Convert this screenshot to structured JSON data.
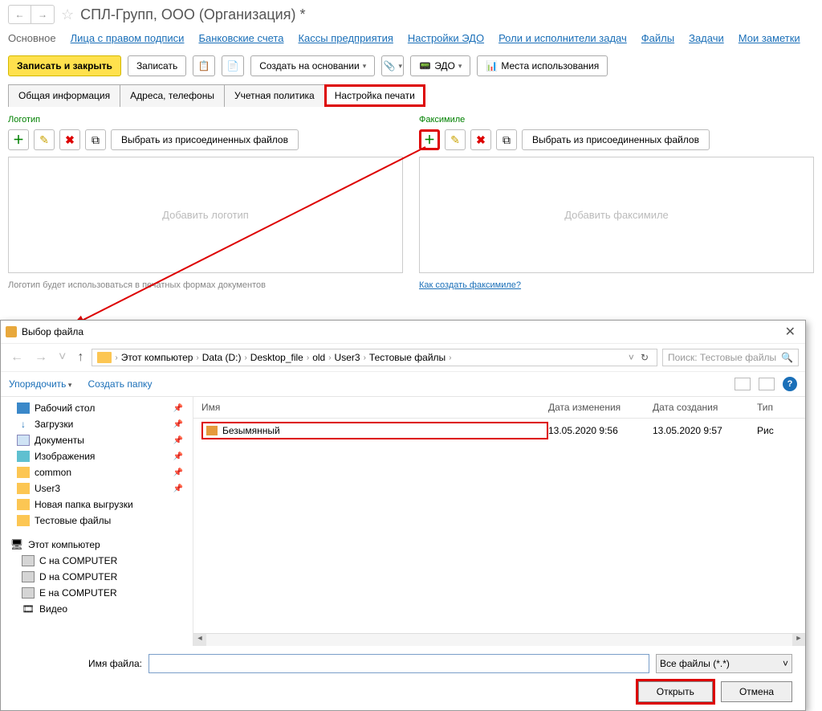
{
  "header": {
    "title": "СПЛ-Групп, ООО (Организация) *"
  },
  "nav": {
    "main": "Основное",
    "links": [
      "Лица с правом подписи",
      "Банковские счета",
      "Кассы предприятия",
      "Настройки ЭДО",
      "Роли и исполнители задач",
      "Файлы",
      "Задачи",
      "Мои заметки"
    ]
  },
  "toolbar": {
    "save_close": "Записать и закрыть",
    "save": "Записать",
    "create_based": "Создать на основании",
    "edo": "ЭДО",
    "usage": "Места использования"
  },
  "tabs": [
    "Общая информация",
    "Адреса, телефоны",
    "Учетная политика",
    "Настройка печати"
  ],
  "logo_panel": {
    "title": "Логотип",
    "select_btn": "Выбрать из присоединенных файлов",
    "placeholder": "Добавить логотип",
    "hint": "Логотип будет использоваться в печатных формах документов"
  },
  "fax_panel": {
    "title": "Факсимиле",
    "select_btn": "Выбрать  из присоединенных файлов",
    "placeholder": "Добавить факсимиле",
    "hint": "Как создать факсимиле?"
  },
  "file_dialog": {
    "title": "Выбор файла",
    "breadcrumbs": [
      "Этот компьютер",
      "Data (D:)",
      "Desktop_file",
      "old",
      "User3",
      "Тестовые файлы"
    ],
    "search_placeholder": "Поиск: Тестовые файлы",
    "organize": "Упорядочить",
    "new_folder": "Создать папку",
    "columns": {
      "name": "Имя",
      "modified": "Дата изменения",
      "created": "Дата создания",
      "type": "Тип"
    },
    "nav_items": [
      {
        "label": "Рабочий стол",
        "ico": "ico-desktop",
        "pin": true
      },
      {
        "label": "Загрузки",
        "ico": "ico-down",
        "pin": true
      },
      {
        "label": "Документы",
        "ico": "ico-doc",
        "pin": true
      },
      {
        "label": "Изображения",
        "ico": "ico-img",
        "pin": true
      },
      {
        "label": "common",
        "ico": "ico-folder",
        "pin": true
      },
      {
        "label": "User3",
        "ico": "ico-folder",
        "pin": true
      },
      {
        "label": "Новая папка выгрузки",
        "ico": "ico-folder",
        "pin": false
      },
      {
        "label": "Тестовые файлы",
        "ico": "ico-folder",
        "pin": false
      }
    ],
    "nav_items2": [
      {
        "label": "Этот компьютер",
        "ico": "ico-pc"
      },
      {
        "label": "C на COMPUTER",
        "ico": "ico-drive"
      },
      {
        "label": "D на COMPUTER",
        "ico": "ico-drive"
      },
      {
        "label": "E на COMPUTER",
        "ico": "ico-drive"
      },
      {
        "label": "Видео",
        "ico": "ico-video"
      }
    ],
    "file": {
      "name": "Безымянный",
      "modified": "13.05.2020 9:56",
      "created": "13.05.2020 9:57",
      "type": "Рис"
    },
    "filename_label": "Имя файла:",
    "filter": "Все файлы (*.*)",
    "open": "Открыть",
    "cancel": "Отмена"
  }
}
